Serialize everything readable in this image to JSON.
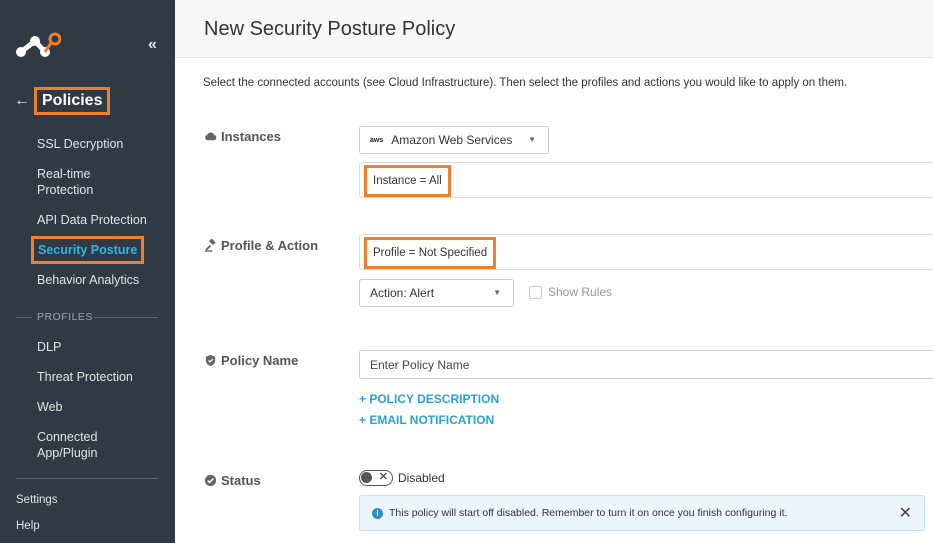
{
  "sidebar": {
    "title": "Policies",
    "collapse_icon": "«",
    "back_icon": "←",
    "items": [
      {
        "label": "SSL Decryption"
      },
      {
        "label": "Real-time Protection"
      },
      {
        "label": "API Data Protection"
      },
      {
        "label": "Security Posture"
      },
      {
        "label": "Behavior Analytics"
      }
    ],
    "section_label": "PROFILES",
    "profile_items": [
      {
        "label": "DLP"
      },
      {
        "label": "Threat Protection"
      },
      {
        "label": "Web"
      },
      {
        "label": "Connected App/Plugin"
      }
    ],
    "bottom_links": [
      {
        "label": "Settings"
      },
      {
        "label": "Help"
      }
    ]
  },
  "main": {
    "title": "New Security Posture Policy",
    "intro": "Select the connected accounts (see Cloud Infrastructure). Then select the profiles and actions you would like to apply on them.",
    "instances": {
      "label": "Instances",
      "provider_badge": "aws",
      "provider": "Amazon Web Services",
      "tag": "Instance = All"
    },
    "profile_action": {
      "label": "Profile & Action",
      "tag": "Profile = Not Specified",
      "action": "Action: Alert",
      "show_rules": "Show Rules"
    },
    "policy_name": {
      "label": "Policy Name",
      "placeholder": "Enter Policy Name",
      "description_link": "+ POLICY DESCRIPTION",
      "email_link": "+ EMAIL NOTIFICATION"
    },
    "status": {
      "label": "Status",
      "toggle_text": "Disabled",
      "alert": "This policy will start off disabled. Remember to turn it on once you finish configuring it."
    }
  },
  "colors": {
    "sidebar_bg": "#2f3a44",
    "accent_blue": "#2ab4ea",
    "highlight_orange": "#f07f2d",
    "link_blue": "#2aa2d6"
  }
}
